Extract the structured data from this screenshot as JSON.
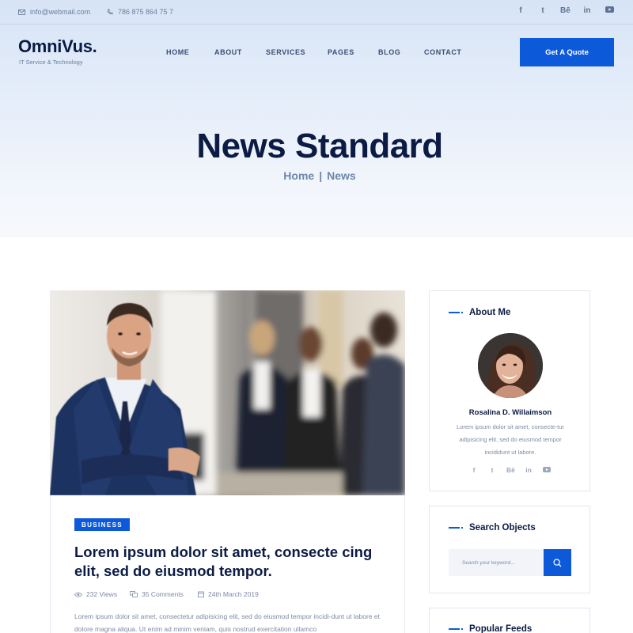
{
  "topbar": {
    "email": "info@webmail.com",
    "phone": "786 875 864 75 7",
    "social": [
      "f",
      "t",
      "Bē",
      "in",
      "yt"
    ]
  },
  "brand": {
    "logo": "OmniVus.",
    "tagline": "IT Service & Technology"
  },
  "nav": {
    "items": [
      "HOME",
      "ABOUT",
      "SERVICES",
      "PAGES",
      "BLOG",
      "CONTACT"
    ],
    "cta": "Get A Quote"
  },
  "hero": {
    "title": "News Standard",
    "breadcrumb": [
      "Home",
      "|",
      "News"
    ]
  },
  "post": {
    "category": "BUSINESS",
    "title": "Lorem ipsum dolor sit amet, consecte cing elit, sed do eiusmod tempor.",
    "views": "232 Views",
    "comments": "35 Comments",
    "date": "24th March 2019",
    "excerpt": "Lorem ipsum dolor sit amet, consectetur adipisicing elit, sed do eiusmod tempor incidi-dunt ut labore et dolore magna aliqua. Ut enim ad minim veniam, quis nostrud exercitation ullamco"
  },
  "sidebar": {
    "about": {
      "title": "About Me",
      "name": "Rosalina D. Willaimson",
      "text": "Lorem ipsum dolor sit amet, consecte-tur adipisicing elit, sed do eiusmod tempor incididunt ut labore.",
      "social": [
        "f",
        "t",
        "Bē",
        "in",
        "yt"
      ]
    },
    "search": {
      "title": "Search Objects",
      "placeholder": "Search your keyword..."
    },
    "popular": {
      "title": "Popular Feeds"
    }
  },
  "colors": {
    "accent": "#0c5ada",
    "heading": "#0b1b44",
    "muted": "#7d8ba4"
  }
}
